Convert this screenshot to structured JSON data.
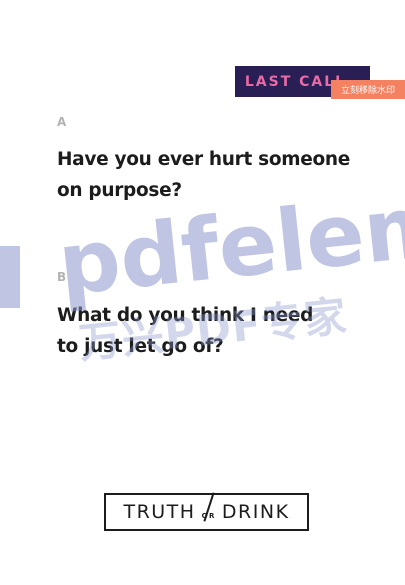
{
  "badge": {
    "label": "LAST CALL"
  },
  "watermark": {
    "remove_label": "立刻移除水印",
    "brand_text": "pdfeleme",
    "brand_cn": "万兴PDF专家"
  },
  "questions": [
    {
      "label": "A",
      "line1": "Have you ever hurt someone",
      "line2": "on purpose?"
    },
    {
      "label": "B",
      "line1": "What do you think I need",
      "line2": "to just let go of?"
    }
  ],
  "logo": {
    "left": "TRUTH",
    "or": "OR",
    "right": "DRINK"
  },
  "colors": {
    "badge_bg": "#2a1f55",
    "badge_text": "#e86aa6",
    "watermark_remove_bg": "#f48160",
    "watermark_tint": "#8c96cd"
  }
}
